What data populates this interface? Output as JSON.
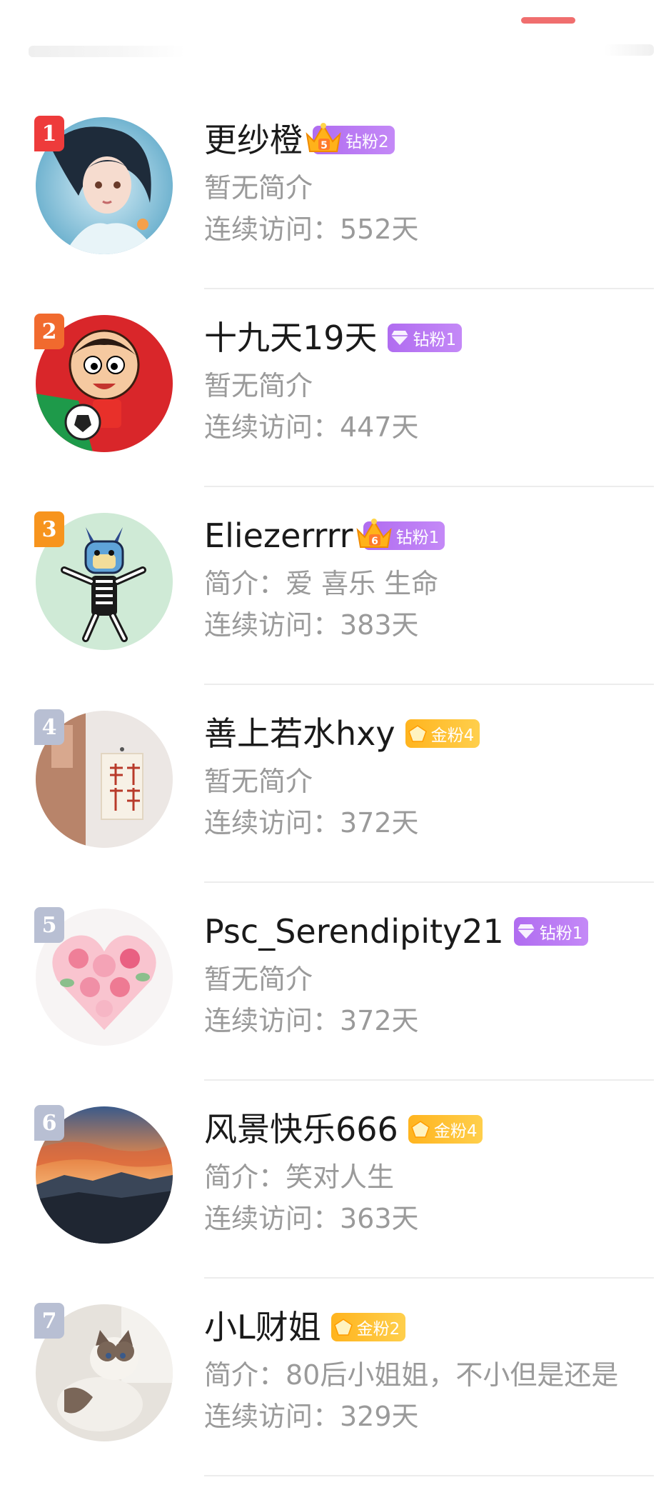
{
  "header": {
    "active_tab_color": "#f06e6e"
  },
  "users": [
    {
      "rank": "1",
      "name": "更纱橙",
      "badge_text": "钻粉2",
      "badge_type": "diamond-crown",
      "crown_level": "5",
      "intro": "暂无简介",
      "visits": "连续访问：552天",
      "avatar_icon": "anime-girl-underwater-avatar"
    },
    {
      "rank": "2",
      "name": "十九天19天",
      "badge_text": "钻粉1",
      "badge_type": "diamond",
      "intro": "暂无简介",
      "visits": "连续访问：447天",
      "avatar_icon": "cartoon-boy-soccer-avatar"
    },
    {
      "rank": "3",
      "name": "Eliezerrrr",
      "badge_text": "钻粉1",
      "badge_type": "diamond-crown",
      "crown_level": "6",
      "intro": "简介：爱 喜乐 生命",
      "visits": "连续访问：383天",
      "avatar_icon": "cartoon-dog-skeleton-avatar"
    },
    {
      "rank": "4",
      "name": "善上若水hxy",
      "badge_text": "金粉4",
      "badge_type": "gold",
      "intro": "暂无简介",
      "visits": "连续访问：372天",
      "avatar_icon": "wall-calligraphy-avatar"
    },
    {
      "rank": "5",
      "name": "Psc_Serendipity21",
      "badge_text": "钻粉1",
      "badge_type": "diamond",
      "intro": "暂无简介",
      "visits": "连续访问：372天",
      "avatar_icon": "flower-heart-avatar"
    },
    {
      "rank": "6",
      "name": "风景快乐666",
      "badge_text": "金粉4",
      "badge_type": "gold",
      "intro": "简介：笑对人生",
      "visits": "连续访问：363天",
      "avatar_icon": "sunset-mountain-avatar"
    },
    {
      "rank": "7",
      "name": "小L财姐",
      "badge_text": "金粉2",
      "badge_type": "gold",
      "intro": "简介：80后小姐姐，不小但是还是",
      "visits": "连续访问：329天",
      "avatar_icon": "ragdoll-cat-avatar"
    }
  ],
  "colors": {
    "rank1": "#ee3b3b",
    "rank2": "#f16a2e",
    "rank3": "#f7941d",
    "rank_other": "#b8bfd3",
    "diamond_badge": "#b06cf0",
    "gold_badge": "#ffb41e"
  }
}
